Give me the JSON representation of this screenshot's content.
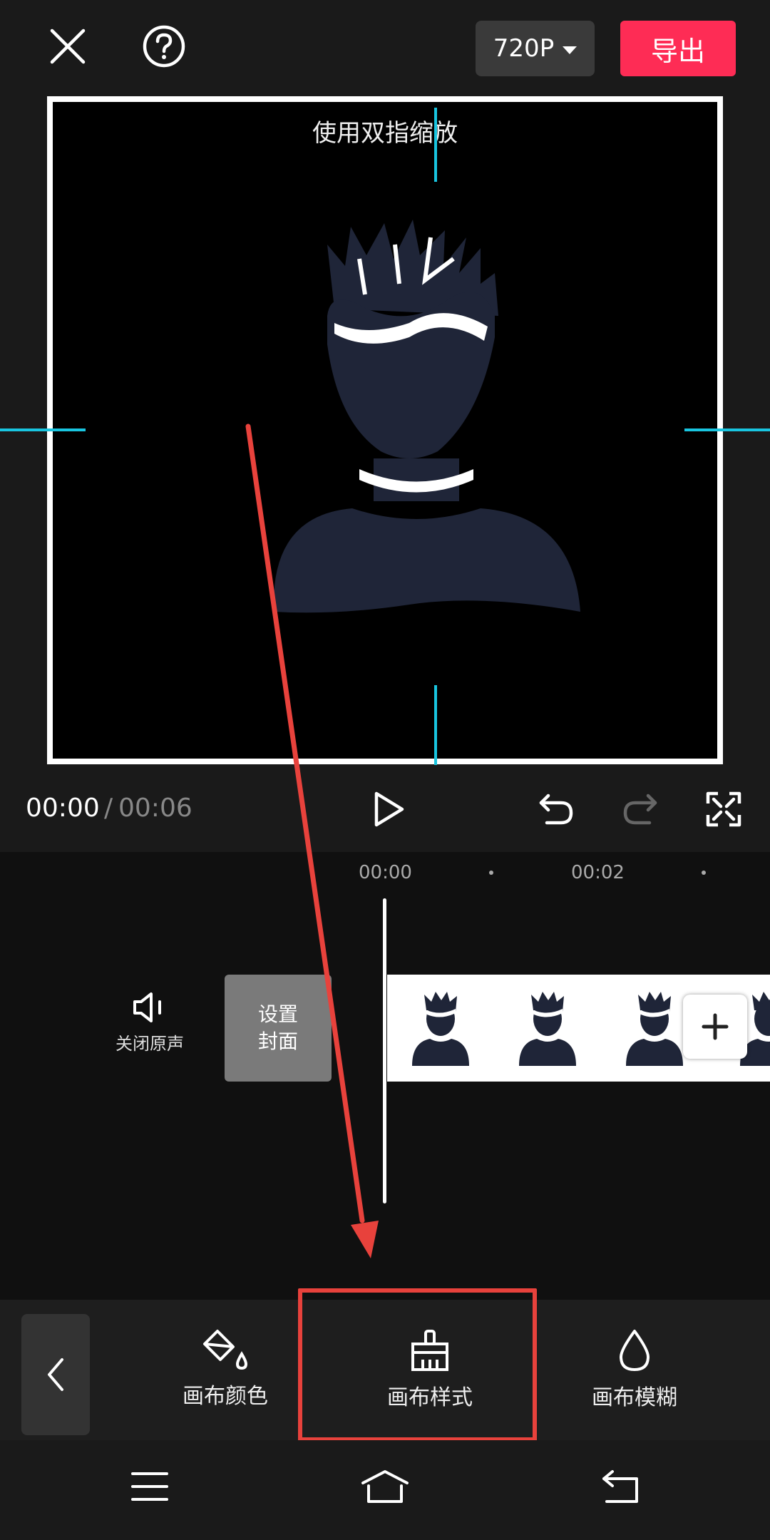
{
  "header": {
    "resolution_label": "720P",
    "export_label": "导出"
  },
  "canvas": {
    "hint": "使用双指缩放"
  },
  "player": {
    "current_time": "00:00",
    "separator": "/",
    "total_time": "00:06"
  },
  "timeline": {
    "ticks": [
      "00:00",
      "00:02"
    ],
    "mute_label": "关闭原声",
    "cover_label_line1": "设置",
    "cover_label_line2": "封面"
  },
  "toolbar": {
    "items": [
      {
        "label": "画布颜色",
        "icon": "paint-bucket-icon"
      },
      {
        "label": "画布样式",
        "icon": "brush-icon"
      },
      {
        "label": "画布模糊",
        "icon": "droplet-icon"
      }
    ]
  },
  "colors": {
    "export_accent": "#fe2c55",
    "guide_cyan": "#19c5e0",
    "annotation_red": "#e8423c",
    "avatar_navy": "#1f2538"
  }
}
